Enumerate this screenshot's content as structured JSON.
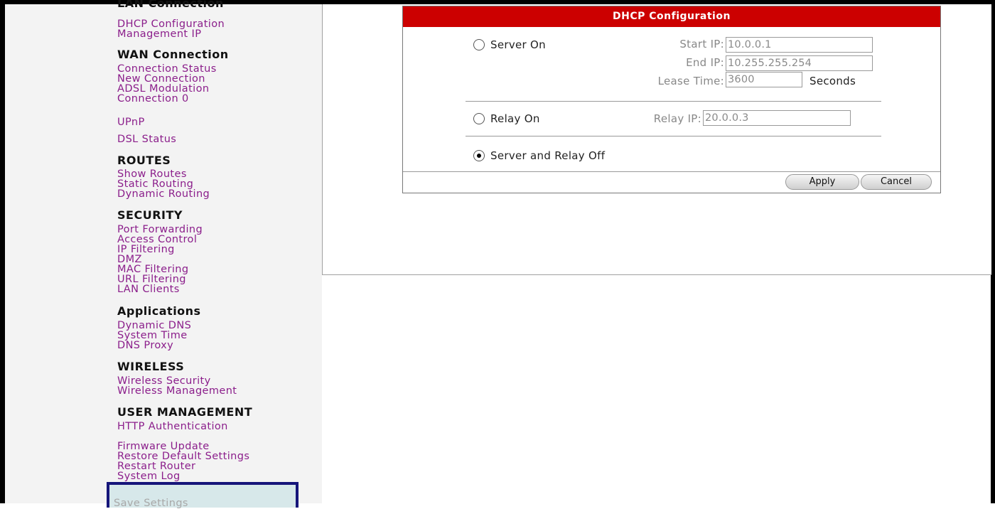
{
  "sidebar": {
    "cut_heading": "LAN Connection",
    "lan_items": [
      "DHCP Configuration",
      "Management IP"
    ],
    "wan_heading": "WAN Connection",
    "wan_items": [
      "Connection Status",
      "New Connection",
      "ADSL Modulation",
      "Connection 0"
    ],
    "upnp": "UPnP",
    "dsl_status": "DSL Status",
    "routes_heading": "ROUTES",
    "routes_items": [
      "Show Routes",
      "Static Routing",
      "Dynamic Routing"
    ],
    "security_heading": "SECURITY",
    "security_items": [
      "Port Forwarding",
      "Access Control",
      "IP Filtering",
      "DMZ",
      "MAC Filtering",
      "URL Filtering",
      "LAN Clients"
    ],
    "applications_heading": "Applications",
    "applications_items": [
      "Dynamic DNS",
      "System Time",
      "DNS Proxy"
    ],
    "wireless_heading": "WIRELESS",
    "wireless_items": [
      "Wireless Security",
      "Wireless Management"
    ],
    "user_mgmt_heading": "USER MANAGEMENT",
    "user_mgmt_items": [
      "HTTP Authentication"
    ],
    "system_items": [
      "Firmware Update",
      "Restore Default Settings",
      "Restart Router",
      "System Log"
    ],
    "save_settings": "Save Settings"
  },
  "dhcp": {
    "title": "DHCP Configuration",
    "server_on": {
      "label": "Server On",
      "selected": false,
      "start_ip_label": "Start IP:",
      "start_ip": "10.0.0.1",
      "end_ip_label": "End IP:",
      "end_ip": "10.255.255.254",
      "lease_label": "Lease Time:",
      "lease_time": "3600",
      "lease_unit": "Seconds"
    },
    "relay_on": {
      "label": "Relay On",
      "selected": false,
      "relay_ip_label": "Relay IP:",
      "relay_ip": "20.0.0.3"
    },
    "off": {
      "label": "Server and Relay Off",
      "selected": true
    },
    "apply_label": "Apply",
    "cancel_label": "Cancel"
  }
}
